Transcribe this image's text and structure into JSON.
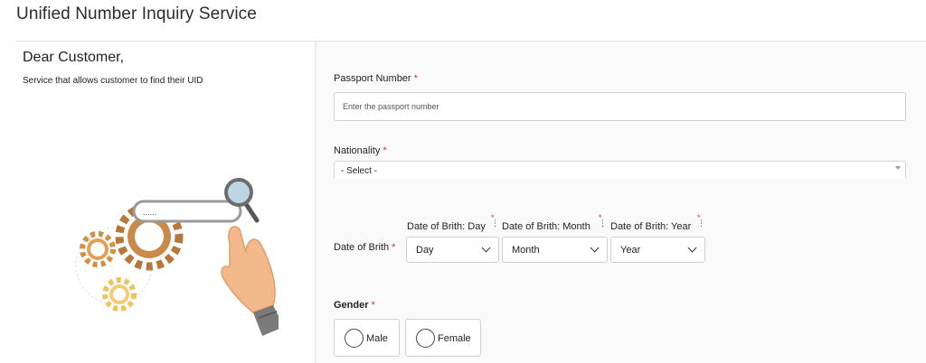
{
  "page": {
    "title": "Unified Number Inquiry Service"
  },
  "intro": {
    "greeting": "Dear Customer,",
    "description": "Service that allows customer to find their UID",
    "search_box_text": "......"
  },
  "form": {
    "required_mark": "*",
    "passport": {
      "label": "Passport Number",
      "placeholder": "Enter the passport number",
      "value": ""
    },
    "nationality": {
      "label": "Nationality",
      "selected": "- Select -"
    },
    "dob": {
      "label": "Date of Brith",
      "day": {
        "label": "Date of Brith: Day",
        "selected": "Day"
      },
      "month": {
        "label": "Date of Brith: Month",
        "selected": "Month"
      },
      "year": {
        "label": "Date of Brith: Year",
        "selected": "Year"
      }
    },
    "gender": {
      "label": "Gender",
      "options": [
        "Male",
        "Female"
      ]
    }
  },
  "colors": {
    "required": "#c0392b",
    "border": "#cfcfcf",
    "gear_brown": "#b5773a",
    "gear_gold": "#e8b04a",
    "hand_skin": "#f2b98a"
  }
}
